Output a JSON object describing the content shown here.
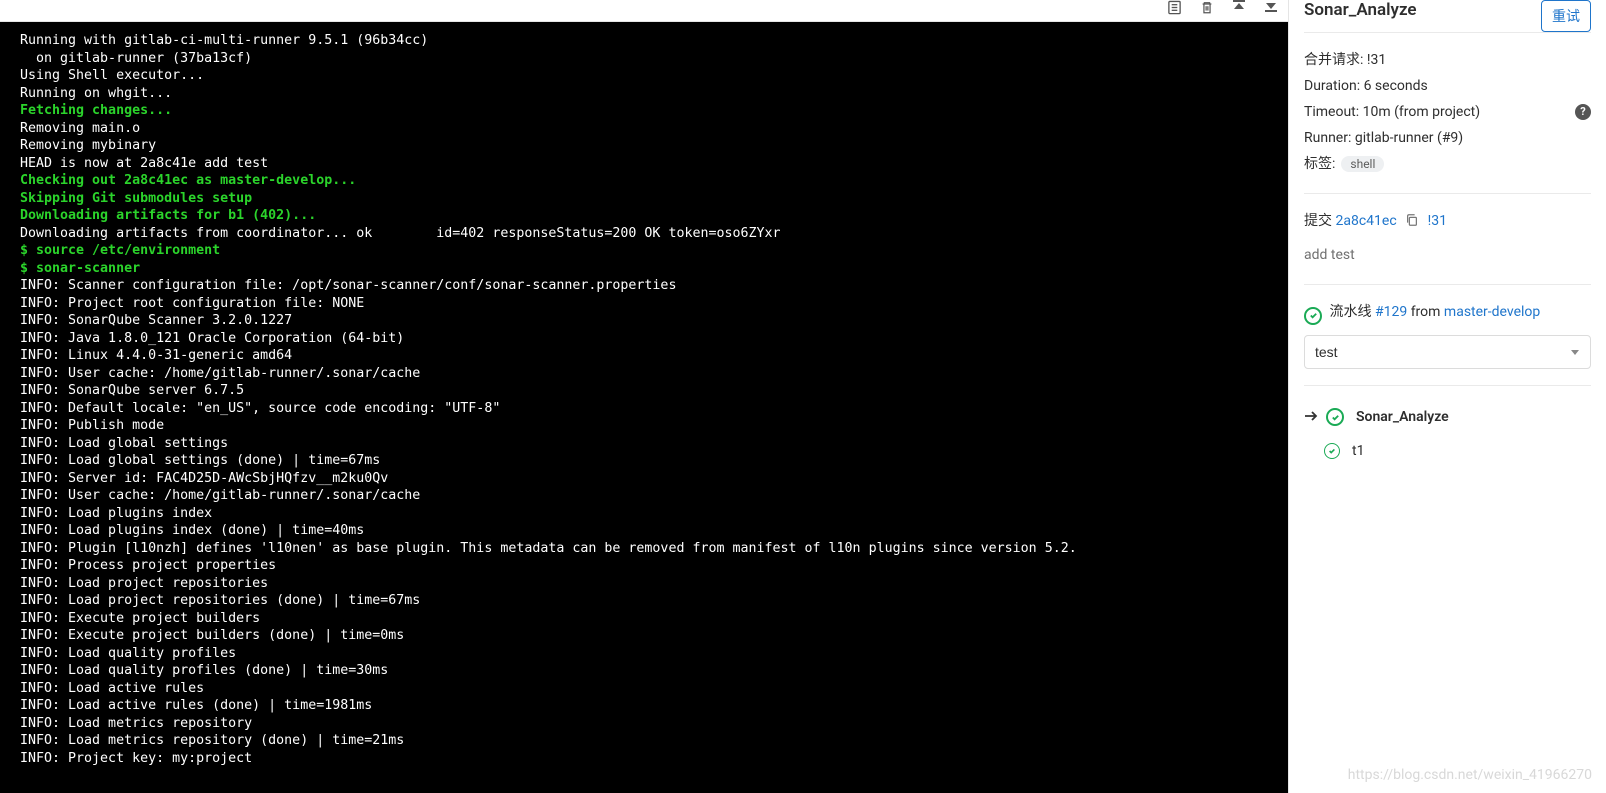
{
  "job_log": [
    {
      "t": "Running with gitlab-ci-multi-runner 9.5.1 (96b34cc)",
      "c": "w"
    },
    {
      "t": "  on gitlab-runner (37ba13cf)",
      "c": "w"
    },
    {
      "t": "Using Shell executor...",
      "c": "w"
    },
    {
      "t": "Running on whgit...",
      "c": "w"
    },
    {
      "t": "Fetching changes...",
      "c": "g"
    },
    {
      "t": "Removing main.o",
      "c": "w"
    },
    {
      "t": "Removing mybinary",
      "c": "w"
    },
    {
      "t": "HEAD is now at 2a8c41e add test",
      "c": "w"
    },
    {
      "t": "Checking out 2a8c41ec as master-develop...",
      "c": "g"
    },
    {
      "t": "Skipping Git submodules setup",
      "c": "g"
    },
    {
      "t": "Downloading artifacts for b1 (402)...",
      "c": "g"
    },
    {
      "t": "Downloading artifacts from coordinator... ok        id=402 responseStatus=200 OK token=oso6ZYxr",
      "c": "w"
    },
    {
      "t": "$ source /etc/environment",
      "c": "g"
    },
    {
      "t": "$ sonar-scanner",
      "c": "g"
    },
    {
      "t": "INFO: Scanner configuration file: /opt/sonar-scanner/conf/sonar-scanner.properties",
      "c": "w"
    },
    {
      "t": "INFO: Project root configuration file: NONE",
      "c": "w"
    },
    {
      "t": "INFO: SonarQube Scanner 3.2.0.1227",
      "c": "w"
    },
    {
      "t": "INFO: Java 1.8.0_121 Oracle Corporation (64-bit)",
      "c": "w"
    },
    {
      "t": "INFO: Linux 4.4.0-31-generic amd64",
      "c": "w"
    },
    {
      "t": "INFO: User cache: /home/gitlab-runner/.sonar/cache",
      "c": "w"
    },
    {
      "t": "INFO: SonarQube server 6.7.5",
      "c": "w"
    },
    {
      "t": "INFO: Default locale: \"en_US\", source code encoding: \"UTF-8\"",
      "c": "w"
    },
    {
      "t": "INFO: Publish mode",
      "c": "w"
    },
    {
      "t": "INFO: Load global settings",
      "c": "w"
    },
    {
      "t": "INFO: Load global settings (done) | time=67ms",
      "c": "w"
    },
    {
      "t": "INFO: Server id: FAC4D25D-AWcSbjHQfzv__m2ku0Qv",
      "c": "w"
    },
    {
      "t": "INFO: User cache: /home/gitlab-runner/.sonar/cache",
      "c": "w"
    },
    {
      "t": "INFO: Load plugins index",
      "c": "w"
    },
    {
      "t": "INFO: Load plugins index (done) | time=40ms",
      "c": "w"
    },
    {
      "t": "INFO: Plugin [l10nzh] defines 'l10nen' as base plugin. This metadata can be removed from manifest of l10n plugins since version 5.2.",
      "c": "w"
    },
    {
      "t": "INFO: Process project properties",
      "c": "w"
    },
    {
      "t": "INFO: Load project repositories",
      "c": "w"
    },
    {
      "t": "INFO: Load project repositories (done) | time=67ms",
      "c": "w"
    },
    {
      "t": "INFO: Execute project builders",
      "c": "w"
    },
    {
      "t": "INFO: Execute project builders (done) | time=0ms",
      "c": "w"
    },
    {
      "t": "INFO: Load quality profiles",
      "c": "w"
    },
    {
      "t": "INFO: Load quality profiles (done) | time=30ms",
      "c": "w"
    },
    {
      "t": "INFO: Load active rules",
      "c": "w"
    },
    {
      "t": "INFO: Load active rules (done) | time=1981ms",
      "c": "w"
    },
    {
      "t": "INFO: Load metrics repository",
      "c": "w"
    },
    {
      "t": "INFO: Load metrics repository (done) | time=21ms",
      "c": "w"
    },
    {
      "t": "INFO: Project key: my:project",
      "c": "w"
    }
  ],
  "side": {
    "title": "Sonar_Analyze",
    "retry": "重试",
    "mr_label": "合并请求:",
    "mr_value": "!31",
    "duration_label": "Duration:",
    "duration_value": "6 seconds",
    "timeout_label": "Timeout:",
    "timeout_value": "10m (from project)",
    "runner_label": "Runner:",
    "runner_value": "gitlab-runner (#9)",
    "tags_label": "标签:",
    "tags_value": "shell",
    "commit_label": "提交",
    "commit_sha": "2a8c41ec",
    "commit_mr": "!31",
    "commit_msg": "add test",
    "pipeline_label": "流水线",
    "pipeline_num": "#129",
    "pipeline_from": "from",
    "pipeline_branch": "master-develop",
    "stage": "test",
    "job_current": "Sonar_Analyze",
    "job_other": "t1"
  },
  "watermark": "https://blog.csdn.net/weixin_41966270"
}
